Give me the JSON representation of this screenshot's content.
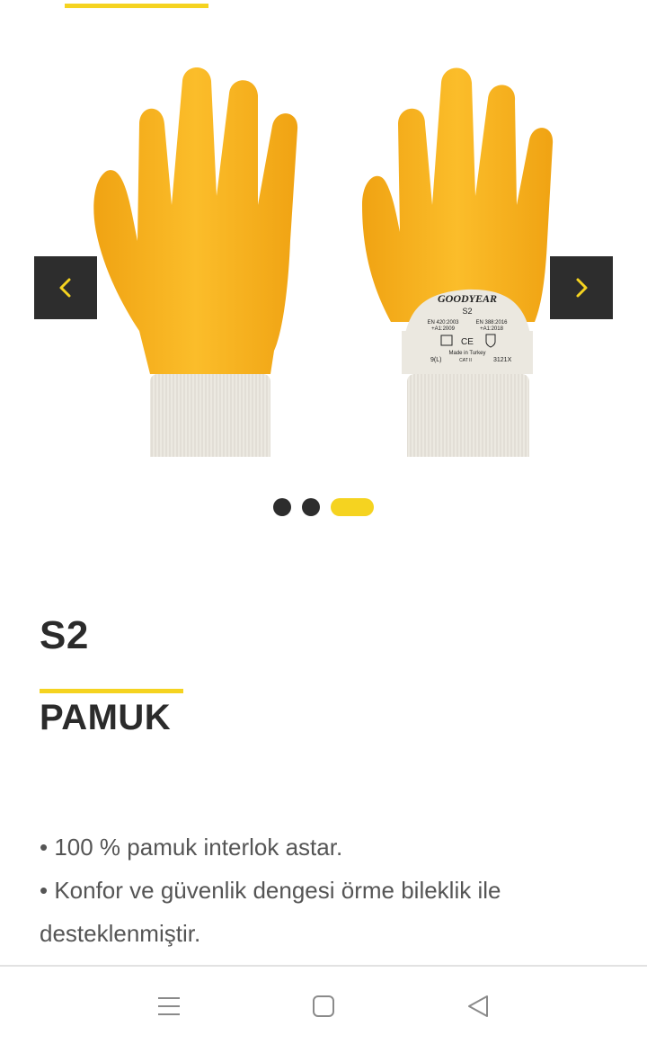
{
  "carousel": {
    "images": [
      {
        "label": "glove-palm-side"
      },
      {
        "label": "glove-back-side"
      }
    ],
    "glove_tag": {
      "brand": "GOODYEAR",
      "model": "S2",
      "std1": "EN 420:2003",
      "std1b": "+A1:2009",
      "std2": "EN 388:2016",
      "std2b": "+A1:2018",
      "made_in": "Made in Turkey",
      "size": "9(L)",
      "cat": "CAT II",
      "code": "3121X"
    },
    "prev_icon": "chevron-left-icon",
    "next_icon": "chevron-right-icon",
    "slide_count": 3,
    "active_slide": 3
  },
  "product": {
    "title": "S2",
    "subtitle": "PAMUK",
    "features": [
      "• 100 % pamuk interlok astar.",
      "• Konfor ve güvenlik dengesi örme bileklik ile desteklenmiştir."
    ]
  },
  "system_nav": {
    "menu_icon": "menu-icon",
    "home_icon": "home-icon",
    "back_icon": "back-icon"
  },
  "colors": {
    "accent": "#f5d320",
    "dark": "#2d2d2d",
    "glove_yellow": "#f7b21f",
    "cuff": "#e9e6de"
  }
}
